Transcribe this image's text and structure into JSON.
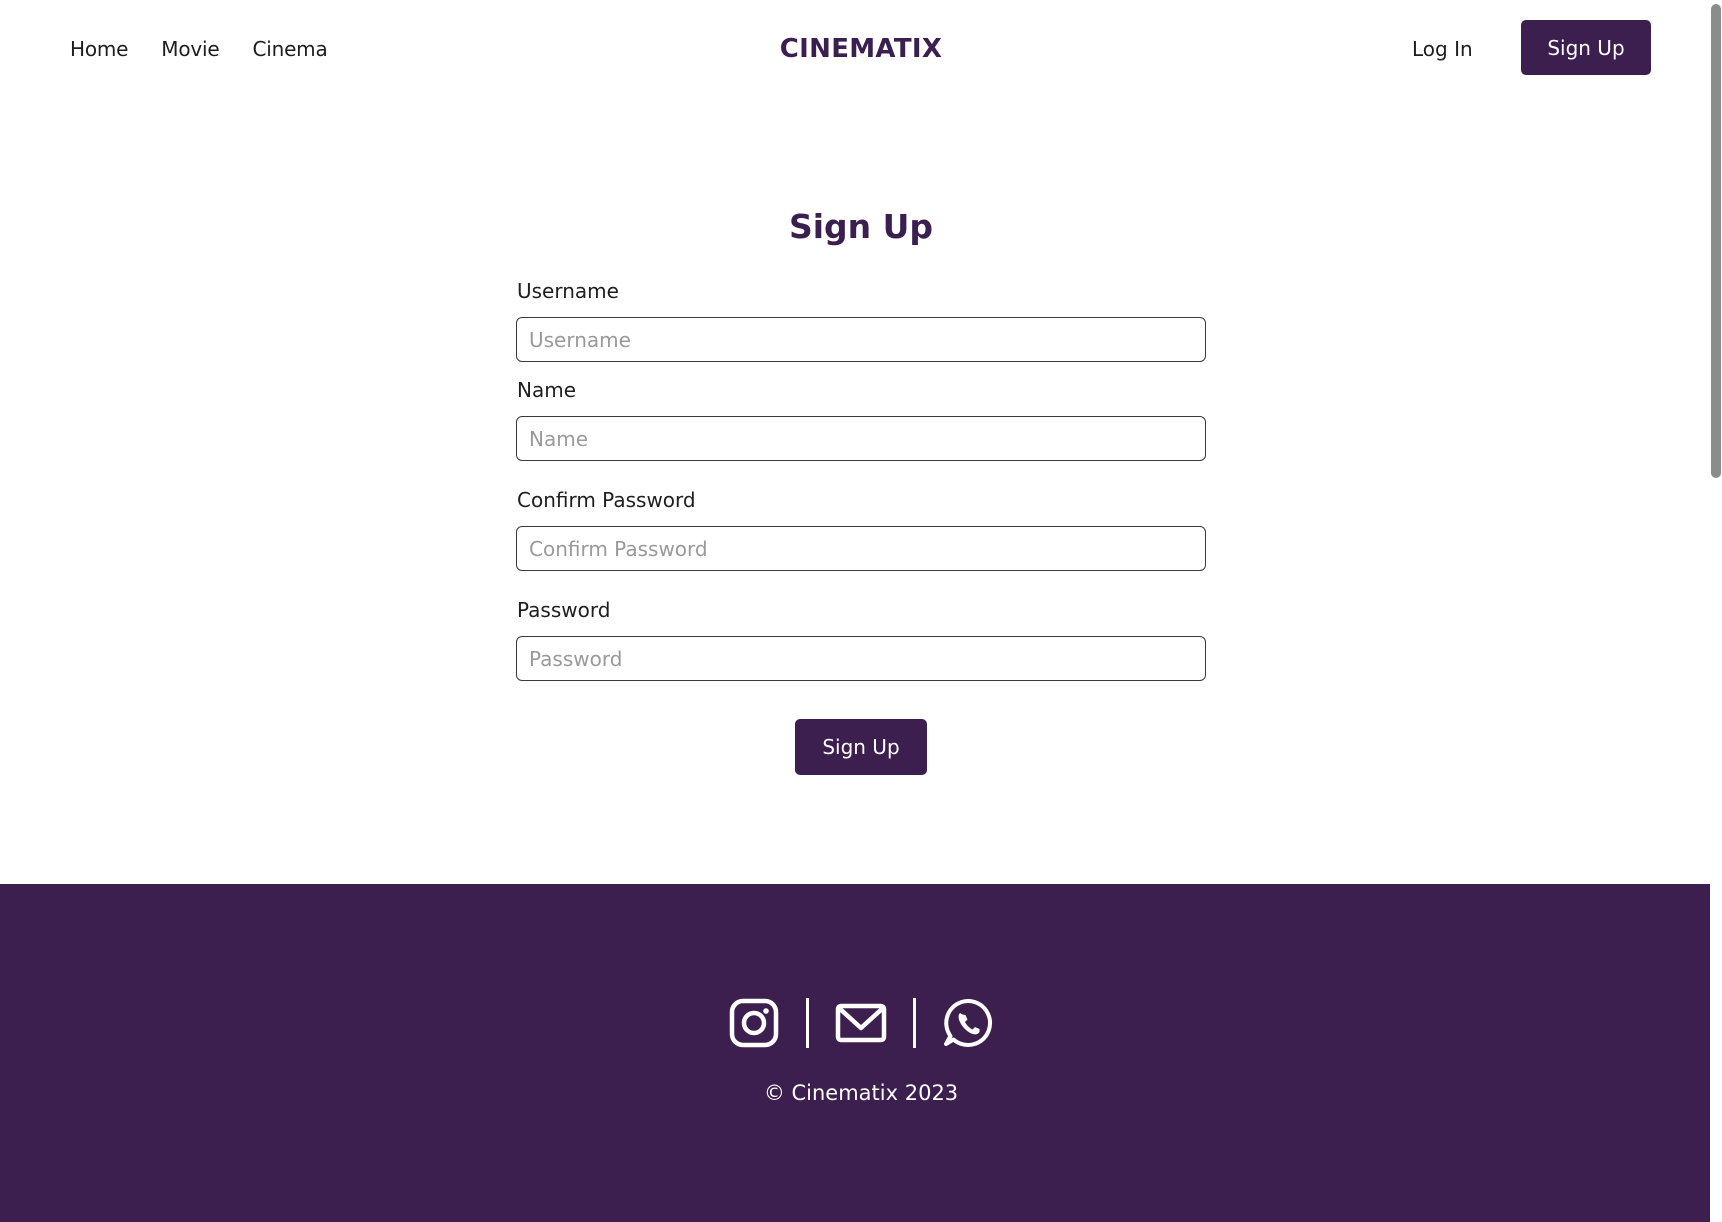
{
  "nav": {
    "links": [
      "Home",
      "Movie",
      "Cinema"
    ],
    "brand": "CINEMATIX",
    "login_label": "Log In",
    "signup_label": "Sign Up"
  },
  "form": {
    "title": "Sign Up",
    "fields": [
      {
        "label": "Username",
        "placeholder": "Username",
        "value": ""
      },
      {
        "label": "Name",
        "placeholder": "Name",
        "value": ""
      },
      {
        "label": "Confirm Password",
        "placeholder": "Confirm Password",
        "value": ""
      },
      {
        "label": "Password",
        "placeholder": "Password",
        "value": ""
      }
    ],
    "submit_label": "Sign Up"
  },
  "footer": {
    "icons": [
      "instagram-icon",
      "mail-icon",
      "whatsapp-icon"
    ],
    "copyright": "© Cinematix 2023"
  },
  "colors": {
    "brand": "#3c1f4e",
    "text": "#1e1e1e",
    "placeholder": "#9a9a9a",
    "footer_text": "#ffffff"
  }
}
